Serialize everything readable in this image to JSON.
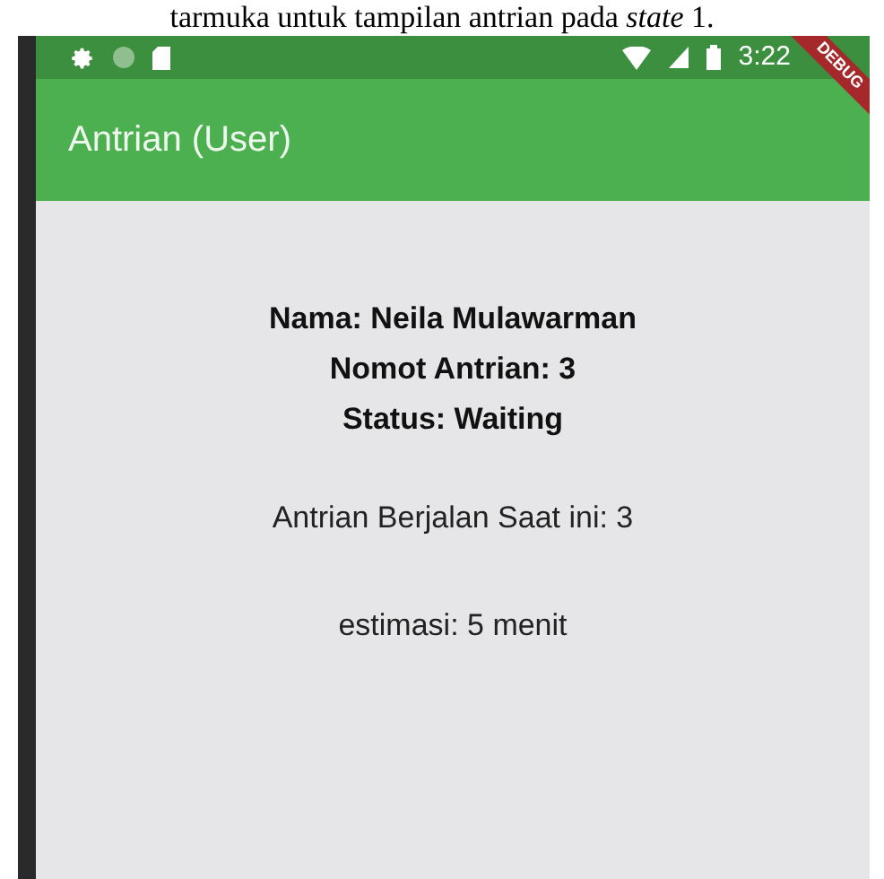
{
  "caption": "tarmuka untuk tampilan antrian pada *state* 1.",
  "status_bar": {
    "time": "3:22"
  },
  "app_bar": {
    "title": "Antrian (User)"
  },
  "debug_banner": "DEBUG",
  "details": [
    "Nama: Neila Mulawarman",
    "Nomot Antrian: 3",
    "Status: Waiting"
  ],
  "current_queue": "Antrian Berjalan Saat ini: 3",
  "estimate": "estimasi: 5 menit"
}
